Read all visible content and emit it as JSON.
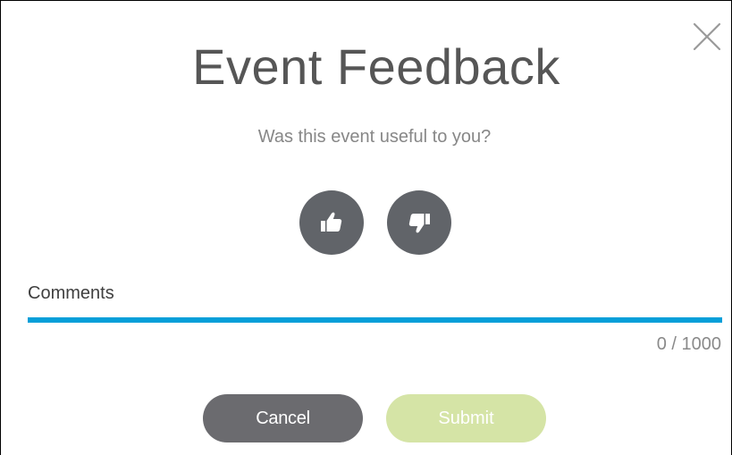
{
  "dialog": {
    "title": "Event Feedback",
    "question": "Was this event useful to you?",
    "close_icon": "close-icon",
    "vote": {
      "up_icon": "thumbs-up-icon",
      "down_icon": "thumbs-down-icon"
    },
    "comments": {
      "label": "Comments",
      "value": "",
      "counter": "0 / 1000"
    },
    "buttons": {
      "cancel_label": "Cancel",
      "submit_label": "Submit"
    },
    "colors": {
      "accent": "#049fd9",
      "vote_button": "#616469",
      "cancel_button": "#6b6b6f",
      "submit_disabled": "#d5e4a6"
    }
  }
}
